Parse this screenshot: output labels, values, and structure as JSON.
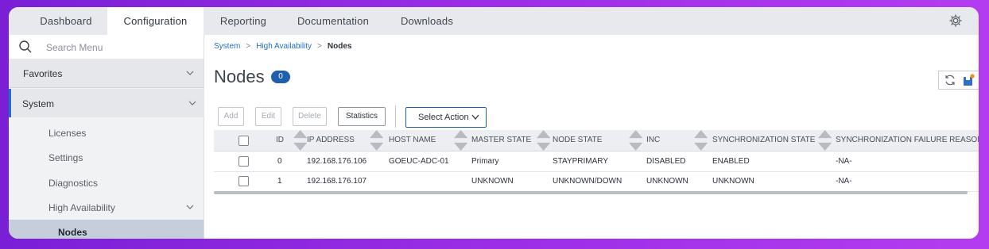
{
  "topnav": {
    "tabs": [
      {
        "label": "Dashboard"
      },
      {
        "label": "Configuration"
      },
      {
        "label": "Reporting"
      },
      {
        "label": "Documentation"
      },
      {
        "label": "Downloads"
      }
    ],
    "active_tab": "Configuration",
    "settings_icon": "gear-icon"
  },
  "sidebar": {
    "search_placeholder": "Search Menu",
    "favorites_label": "Favorites",
    "system_label": "System",
    "items": [
      {
        "label": "Licenses"
      },
      {
        "label": "Settings"
      },
      {
        "label": "Diagnostics"
      },
      {
        "label": "High Availability"
      },
      {
        "label": "Nodes"
      }
    ]
  },
  "breadcrumb": {
    "items": [
      "System",
      "High Availability",
      "Nodes"
    ]
  },
  "page": {
    "title": "Nodes",
    "count": "0"
  },
  "toolbar": {
    "add_label": "Add",
    "edit_label": "Edit",
    "delete_label": "Delete",
    "statistics_label": "Statistics",
    "select_action_label": "Select Action"
  },
  "table": {
    "headers": [
      "ID",
      "IP ADDRESS",
      "HOST NAME",
      "MASTER STATE",
      "NODE STATE",
      "INC",
      "SYNCHRONIZATION STATE",
      "SYNCHRONIZATION FAILURE REASON"
    ],
    "rows": [
      [
        "0",
        "192.168.176.106",
        "GOEUC-ADC-01",
        "Primary",
        "STAYPRIMARY",
        "DISABLED",
        "ENABLED",
        "-NA-"
      ],
      [
        "1",
        "192.168.176.107",
        "",
        "UNKNOWN",
        "UNKNOWN/DOWN",
        "UNKNOWN",
        "UNKNOWN",
        "-NA-"
      ]
    ]
  },
  "colors": {
    "accent": "#1f5fae",
    "frame_gradient_start": "#7a1fd6",
    "frame_gradient_end": "#b43cf0",
    "selected_nav": "#c7cedb"
  }
}
